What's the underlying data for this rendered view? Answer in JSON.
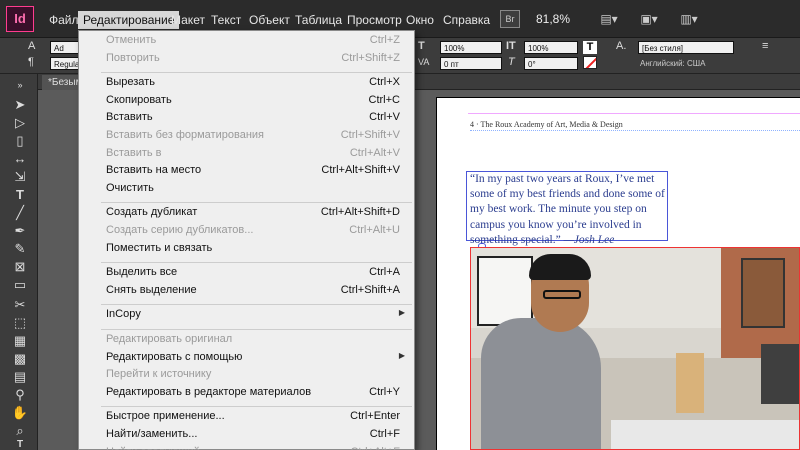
{
  "app": {
    "logo": "Id"
  },
  "menubar": {
    "items": [
      "Файл",
      "Редактирование",
      "Макет",
      "Текст",
      "Объект",
      "Таблица",
      "Просмотр",
      "Окно",
      "Справка"
    ],
    "bridge": "Br",
    "zoom": "81,8%",
    "view_icon": "view-options-icon",
    "screen_mode_icon": "screen-mode-icon",
    "arrange_icon": "arrange-documents-icon"
  },
  "control_panel": {
    "font_partial": "Ad",
    "style_partial": "Regular",
    "scale_h": "100%",
    "scale_v": "100%",
    "tracking": "0 пт",
    "skew": "0°",
    "para_style": "[Без стиля]",
    "language": "Английский: США"
  },
  "document": {
    "tab": "*Безым",
    "running_head": "4 · The Roux Academy of Art, Media & Design",
    "quote": "“In my past two years at Roux, I’ve met some of my best friends and done some of my best work. The minute you step on campus you know you’re involved in something special.”",
    "attribution": "—Josh Lee"
  },
  "edit_menu": [
    {
      "label": "Отменить",
      "shortcut": "Ctrl+Z",
      "disabled": true
    },
    {
      "label": "Повторить",
      "shortcut": "Ctrl+Shift+Z",
      "disabled": true
    },
    {
      "sep": true
    },
    {
      "label": "Вырезать",
      "shortcut": "Ctrl+X",
      "disabled": false
    },
    {
      "label": "Скопировать",
      "shortcut": "Ctrl+C",
      "disabled": false
    },
    {
      "label": "Вставить",
      "shortcut": "Ctrl+V",
      "disabled": false
    },
    {
      "label": "Вставить без форматирования",
      "shortcut": "Ctrl+Shift+V",
      "disabled": true
    },
    {
      "label": "Вставить в",
      "shortcut": "Ctrl+Alt+V",
      "disabled": true
    },
    {
      "label": "Вставить на место",
      "shortcut": "Ctrl+Alt+Shift+V",
      "disabled": false
    },
    {
      "label": "Очистить",
      "shortcut": "",
      "disabled": false
    },
    {
      "sep": true
    },
    {
      "label": "Создать дубликат",
      "shortcut": "Ctrl+Alt+Shift+D",
      "disabled": false
    },
    {
      "label": "Создать серию дубликатов...",
      "shortcut": "Ctrl+Alt+U",
      "disabled": true
    },
    {
      "label": "Поместить и связать",
      "shortcut": "",
      "disabled": false
    },
    {
      "sep": true
    },
    {
      "label": "Выделить все",
      "shortcut": "Ctrl+A",
      "disabled": false
    },
    {
      "label": "Снять выделение",
      "shortcut": "Ctrl+Shift+A",
      "disabled": false
    },
    {
      "sep": true
    },
    {
      "label": "InCopy",
      "shortcut": "",
      "disabled": false,
      "submenu": true
    },
    {
      "sep": true
    },
    {
      "label": "Редактировать оригинал",
      "shortcut": "",
      "disabled": true
    },
    {
      "label": "Редактировать с помощью",
      "shortcut": "",
      "disabled": false,
      "submenu": true
    },
    {
      "label": "Перейти к источнику",
      "shortcut": "",
      "disabled": true
    },
    {
      "label": "Редактировать в редакторе материалов",
      "shortcut": "Ctrl+Y",
      "disabled": false
    },
    {
      "sep": true
    },
    {
      "label": "Быстрое применение...",
      "shortcut": "Ctrl+Enter",
      "disabled": false
    },
    {
      "label": "Найти/заменить...",
      "shortcut": "Ctrl+F",
      "disabled": false
    },
    {
      "label": "Найти следующий",
      "shortcut": "Ctrl+Alt+F",
      "disabled": true
    }
  ],
  "tools": [
    "selection-icon",
    "direct-selection-icon",
    "page-tool-icon",
    "gap-tool-icon",
    "content-collector-icon",
    "type-tool-icon",
    "line-tool-icon",
    "pen-tool-icon",
    "pencil-tool-icon",
    "rectangle-frame-icon",
    "rectangle-tool-icon",
    "scissors-icon",
    "free-transform-icon",
    "gradient-swatch-icon",
    "gradient-feather-icon",
    "note-tool-icon",
    "eyedropper-icon",
    "hand-tool-icon",
    "zoom-tool-icon",
    "fill-stroke-icon"
  ],
  "colors": {
    "menubar_bg": "#2b2b2b",
    "panel_bg": "#3c3c3c",
    "pasteboard": "#5b5b5b",
    "menu_bg": "#efefef",
    "frame_blue": "#4a56d8",
    "frame_red": "#ee3333",
    "logo_pink": "#ff3c8e"
  }
}
